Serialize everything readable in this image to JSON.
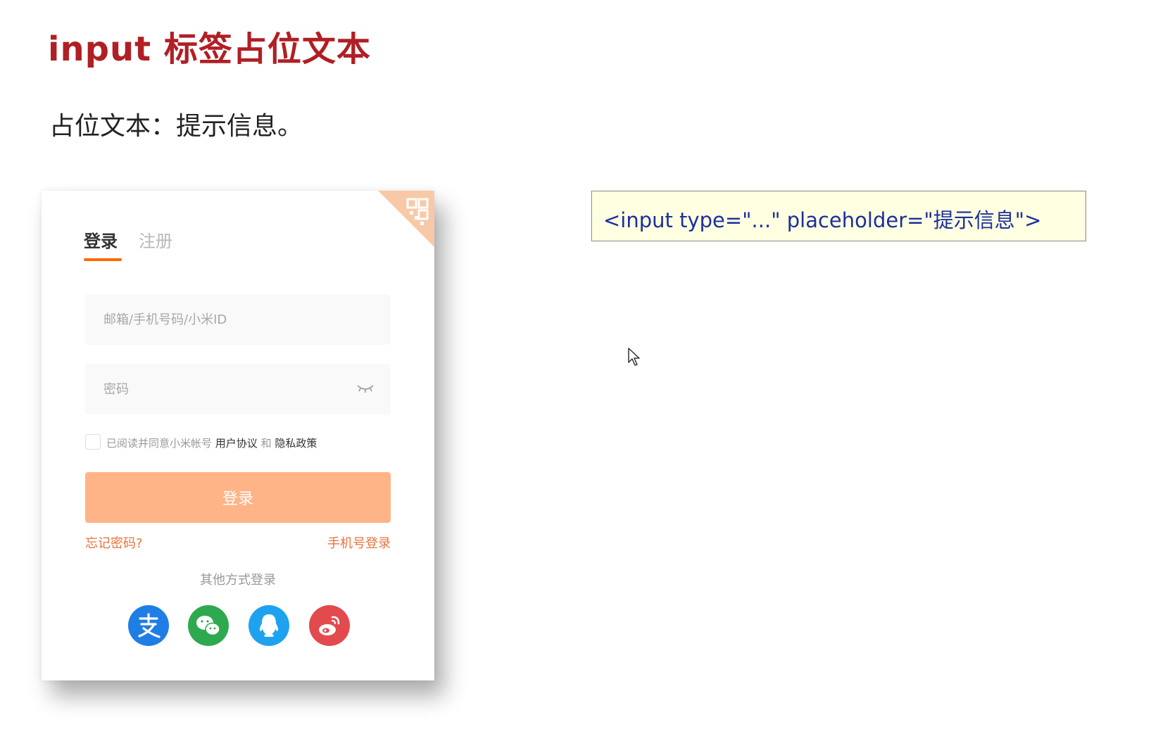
{
  "slide": {
    "title": "input 标签占位文本",
    "subtitle": "占位文本：提示信息。"
  },
  "login_card": {
    "tabs": [
      {
        "label": "登录",
        "active": true
      },
      {
        "label": "注册",
        "active": false
      }
    ],
    "account_input": {
      "placeholder": "邮箱/手机号码/小米ID",
      "value": ""
    },
    "password_input": {
      "placeholder": "密码",
      "value": ""
    },
    "agreement": {
      "prefix": "已阅读并同意小米帐号",
      "link1": "用户协议",
      "joiner": "和",
      "link2": "隐私政策",
      "checked": false
    },
    "login_button": "登录",
    "forgot_password": "忘记密码?",
    "phone_login": "手机号登录",
    "other_methods": "其他方式登录",
    "social_icons": [
      "alipay-icon",
      "wechat-icon",
      "qq-icon",
      "weibo-icon"
    ]
  },
  "code_example": "<input type=\"...\" placeholder=\"提示信息\">",
  "colors": {
    "title": "#b01f24",
    "accent": "#ff6900",
    "button": "#ffb487",
    "link": "#e8733f",
    "code_bg": "#ffffe1",
    "code_text": "#1c2f9e"
  }
}
